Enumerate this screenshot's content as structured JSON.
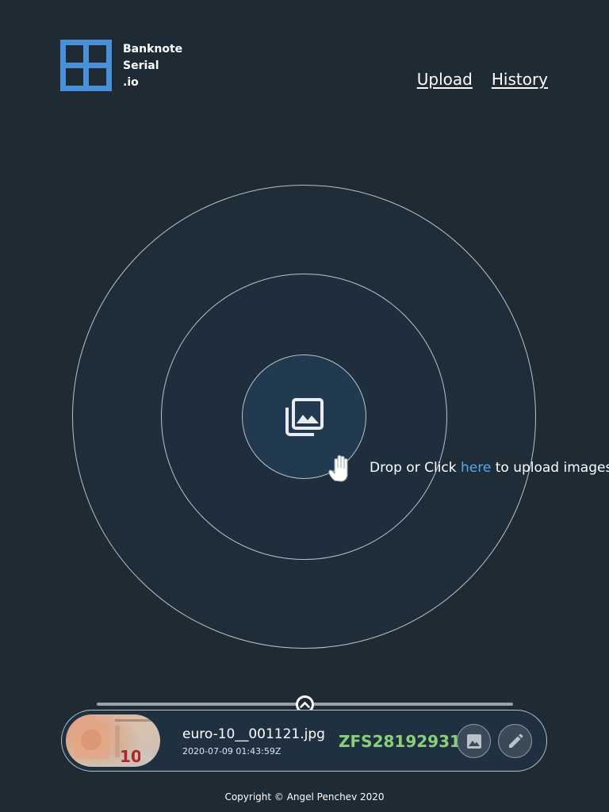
{
  "brand": {
    "line1": "Banknote",
    "line2": "Serial",
    "line3": ".io",
    "logo_icon": "grid-logo-icon",
    "accent": "#4a90d9"
  },
  "nav": {
    "upload": "Upload",
    "history": "History"
  },
  "dropzone": {
    "icon": "image-library-icon",
    "pointer_icon": "hand-pointer-icon",
    "text_before": "Drop or Click ",
    "link": "here",
    "text_after": " to upload images",
    "link_color": "#5aa7e6"
  },
  "results": {
    "toggle_icon": "chevron-up-icon",
    "items": [
      {
        "file_name": "euro-10__001121.jpg",
        "timestamp": "2020-07-09 01:43:59Z",
        "serial": "ZFS28192931",
        "serial_color": "#8bcf7c",
        "thumb_icon": "banknote-thumbnail"
      }
    ],
    "view_icon": "image-icon",
    "edit_icon": "pencil-icon"
  },
  "footer": {
    "copyright": "Copyright © Angel Penchev 2020"
  }
}
